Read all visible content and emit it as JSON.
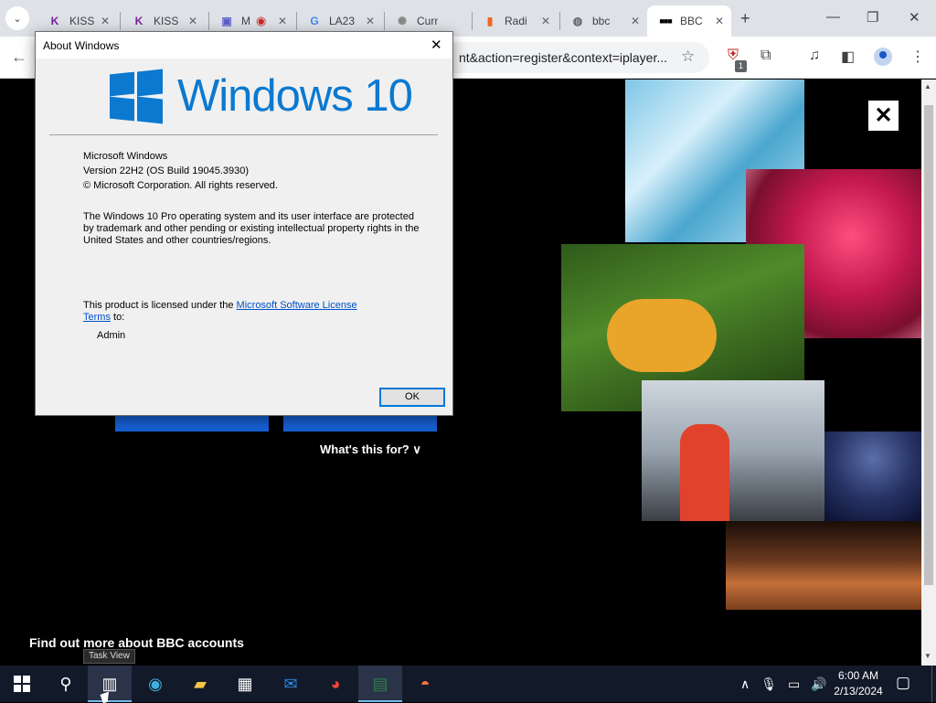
{
  "browser": {
    "tabs": [
      {
        "title": "KISS",
        "favicon": "K",
        "fav_color": "#7b1fa2"
      },
      {
        "title": "KISS",
        "favicon": "K",
        "fav_color": "#7b1fa2"
      },
      {
        "title": "M",
        "favicon": "teams-icon",
        "fav_color": "#5b5fc7"
      },
      {
        "title": "LA23",
        "favicon": "G",
        "fav_color": "#4285f4"
      },
      {
        "title": "Curr",
        "favicon": "spinner-icon",
        "fav_color": "#888888"
      },
      {
        "title": "Radi",
        "favicon": "radio-icon",
        "fav_color": "#f26522"
      },
      {
        "title": "bbc",
        "favicon": "globe-icon",
        "fav_color": "#5f6368"
      },
      {
        "title": "BBC",
        "favicon": "bbc-icon",
        "fav_color": "#000000"
      }
    ],
    "active_tab_index": 7,
    "url_visible": "nt&action=register&context=iplayer...",
    "extension_badge": "1"
  },
  "dialog": {
    "title": "About Windows",
    "product_name": "Windows 10",
    "line1": "Microsoft Windows",
    "line2": "Version 22H2 (OS Build 19045.3930)",
    "line3": "© Microsoft Corporation. All rights reserved.",
    "legal": "The Windows 10 Pro operating system and its user interface are protected by trademark and other pending or existing intellectual property rights in the United States and other countries/regions.",
    "license_prefix": "This product is licensed under the ",
    "license_link": "Microsoft Software License Terms",
    "license_suffix": " to:",
    "licensed_user": "Admin",
    "ok_label": "OK"
  },
  "page": {
    "whats_this": "What's this for?",
    "find_more": "Find out more about BBC accounts",
    "close_label": "✕"
  },
  "taskbar": {
    "tooltip": "Task View",
    "time": "6:00 AM",
    "date": "2/13/2024"
  },
  "colors": {
    "windows_blue": "#0b79d0",
    "bbc_blue": "#1561d6",
    "taskbar": "#121a2a"
  }
}
